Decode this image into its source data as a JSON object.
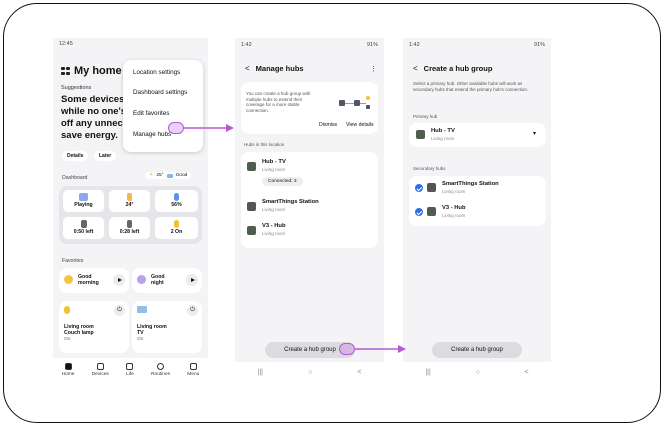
{
  "phone1": {
    "time": "12:45",
    "home_title": "My home",
    "suggestions_label": "Suggestions",
    "suggestion_lines": [
      "Some devices",
      "while no one's",
      "off any unnece",
      "save energy."
    ],
    "details_btn": "Details",
    "later_btn": "Later",
    "menu": {
      "items": [
        "Location settings",
        "Dashboard settings",
        "Edit favorites",
        "Manage hubs"
      ]
    },
    "dashboard_label": "Dashboard",
    "weather": {
      "temp": "25°",
      "quality": "Good"
    },
    "tiles": [
      {
        "label": "Playing",
        "color": "#8fa9e8"
      },
      {
        "label": "24°",
        "color": "#f2b64a"
      },
      {
        "label": "56%",
        "color": "#5a95e0"
      },
      {
        "label": "0:50 left",
        "color": "#666666"
      },
      {
        "label": "0:28 left",
        "color": "#666666"
      },
      {
        "label": "2 On",
        "color": "#f2c230"
      }
    ],
    "favorites_label": "Favorites",
    "favorites": [
      {
        "title": "Good",
        "title2": "morning"
      },
      {
        "title": "Good",
        "title2": "night"
      }
    ],
    "devices": [
      {
        "room": "Living room",
        "name": "Couch lamp",
        "state": "On"
      },
      {
        "room": "Living room",
        "name": "TV",
        "state": "On"
      }
    ],
    "nav": [
      "Home",
      "Devices",
      "Life",
      "Routines",
      "Menu"
    ]
  },
  "phone2": {
    "status_left": "1:42",
    "status_right": "91%",
    "title": "Manage hubs",
    "info_text": "You can create a hub group with multiple hubs to extend their coverage for a more stable connection.",
    "dismiss": "Dismiss",
    "view_details": "View details",
    "section": "Hubs in this location",
    "hubs": [
      {
        "name": "Hub - TV",
        "sub": "Living room"
      },
      {
        "name": "SmartThings Station",
        "sub": "Living room"
      },
      {
        "name": "V3 - Hub",
        "sub": "Living room"
      }
    ],
    "connected": "Connected: 3",
    "button": "Create a hub group"
  },
  "phone3": {
    "status_left": "1:42",
    "status_right": "91%",
    "title": "Create a hub group",
    "description": "Select a primary hub. Other available hubs will work as secondary hubs that extend the primary hub's connection.",
    "primary_label": "Primary hub",
    "primary": {
      "name": "Hub - TV",
      "sub": "Living room"
    },
    "secondary_label": "Secondary hubs",
    "secondary": [
      {
        "name": "SmartThings Station",
        "sub": "Living room"
      },
      {
        "name": "V3 - Hub",
        "sub": "Living room"
      }
    ],
    "button": "Create a hub group"
  },
  "colors": {
    "highlight": "#b45ad6",
    "accent": "#2f6fe8"
  }
}
